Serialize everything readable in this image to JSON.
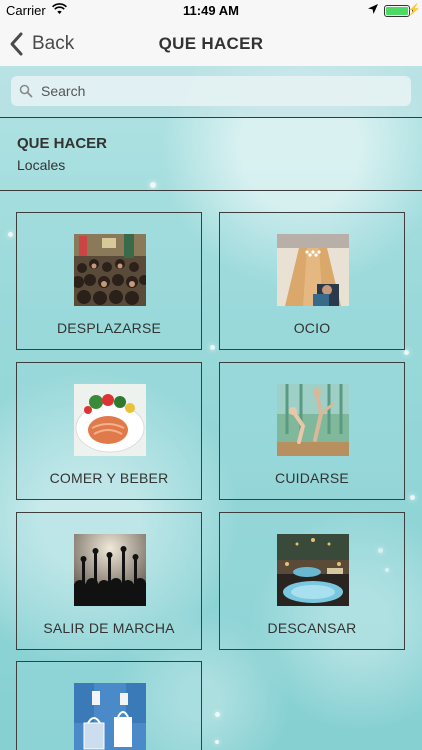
{
  "status_bar": {
    "carrier": "Carrier",
    "time": "11:49 AM"
  },
  "nav": {
    "back_label": "Back",
    "title": "QUE HACER"
  },
  "search": {
    "placeholder": "Search"
  },
  "section": {
    "title": "QUE HACER",
    "subtitle": "Locales"
  },
  "tiles": [
    {
      "label": "DESPLAZARSE",
      "icon": "crowd-street-photo"
    },
    {
      "label": "OCIO",
      "icon": "bowling-alley-photo"
    },
    {
      "label": "COMER Y BEBER",
      "icon": "salmon-dish-photo"
    },
    {
      "label": "CUIDARSE",
      "icon": "yoga-photo"
    },
    {
      "label": "SALIR DE MARCHA",
      "icon": "concert-crowd-photo"
    },
    {
      "label": "DESCANSAR",
      "icon": "pool-lounge-photo"
    },
    {
      "label": "",
      "icon": "shopping-bags-photo"
    }
  ],
  "colors": {
    "background": "#9ad9da",
    "nav_bar": "#f7f7f7",
    "battery": "#4cd964"
  }
}
